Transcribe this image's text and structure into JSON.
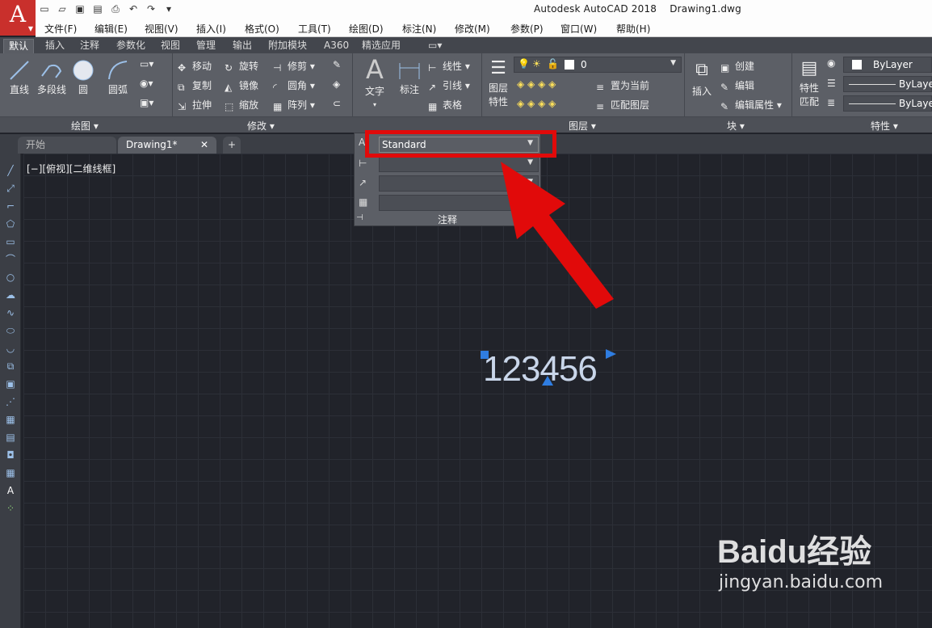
{
  "window": {
    "title": "Autodesk AutoCAD 2018",
    "file": "Drawing1.dwg"
  },
  "menu": [
    "文件(F)",
    "编辑(E)",
    "视图(V)",
    "插入(I)",
    "格式(O)",
    "工具(T)",
    "绘图(D)",
    "标注(N)",
    "修改(M)",
    "参数(P)",
    "窗口(W)",
    "帮助(H)"
  ],
  "ribbon_tabs": [
    "默认",
    "插入",
    "注释",
    "参数化",
    "视图",
    "管理",
    "输出",
    "附加模块",
    "A360",
    "精选应用"
  ],
  "draw": {
    "line": "直线",
    "polyline": "多段线",
    "circle": "圆",
    "arc": "圆弧",
    "panel": "绘图"
  },
  "modify": {
    "move": "移动",
    "rotate": "旋转",
    "trim": "修剪",
    "copy": "复制",
    "mirror": "镜像",
    "fillet": "圆角",
    "stretch": "拉伸",
    "scale": "缩放",
    "array": "阵列",
    "panel": "修改"
  },
  "annotation": {
    "text": "文字",
    "dim": "标注",
    "linear": "线性",
    "leader": "引线",
    "table": "表格",
    "panel": "注释"
  },
  "layers": {
    "layerprops": "图层",
    "layerprops2": "特性",
    "current_layer": "0",
    "make_current": "置为当前",
    "match": "匹配图层",
    "panel": "图层"
  },
  "block": {
    "insert": "插入",
    "create": "创建",
    "edit": "编辑",
    "editattr": "编辑属性",
    "panel": "块"
  },
  "properties": {
    "match": "特性",
    "match2": "匹配",
    "bylayer1": "ByLayer",
    "bylayer2": "ByLayer",
    "bylayer3": "ByLayer",
    "panel": "特性"
  },
  "doctabs": {
    "start": "开始",
    "drawing": "Drawing1*",
    "add": "+"
  },
  "viewport_label": "[−][俯视][二维线框]",
  "text_style_dropdown": {
    "value": "Standard"
  },
  "text_object": "123456",
  "watermark": {
    "brand": "Baidu经验",
    "url": "jingyan.baidu.com"
  },
  "accent_red": "#e10a0a"
}
